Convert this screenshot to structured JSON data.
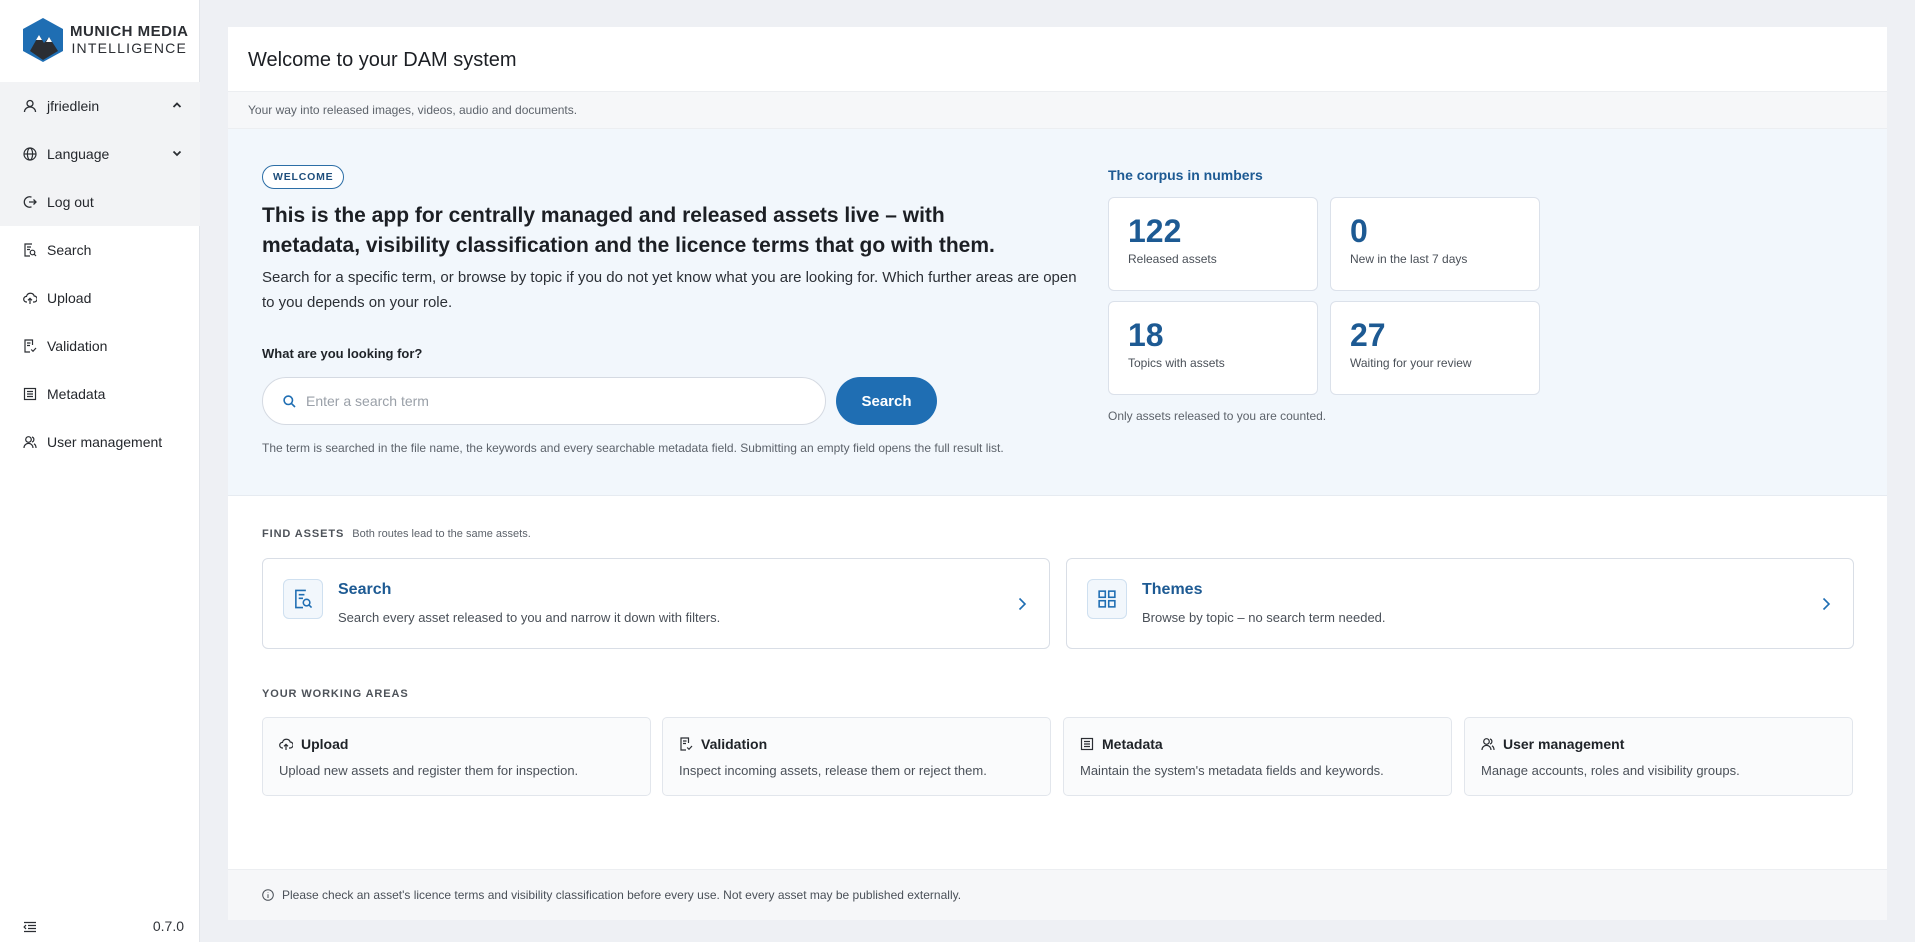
{
  "brand": {
    "line1": "MUNICH MEDIA",
    "line2": "INTELLIGENCE"
  },
  "sidebar": {
    "user": {
      "label": "jfriedlein",
      "icon": "user-icon"
    },
    "language": {
      "label": "Language",
      "icon": "globe-icon"
    },
    "logout": {
      "label": "Log out",
      "icon": "logout-icon"
    },
    "items": [
      {
        "label": "Search",
        "icon": "search-doc-icon"
      },
      {
        "label": "Upload",
        "icon": "cloud-upload-icon"
      },
      {
        "label": "Validation",
        "icon": "check-doc-icon"
      },
      {
        "label": "Metadata",
        "icon": "list-doc-icon"
      },
      {
        "label": "User management",
        "icon": "users-icon"
      }
    ],
    "version": "0.7.0"
  },
  "header": {
    "title": "Welcome to your DAM system",
    "subtitle": "Your way into released images, videos, audio and documents."
  },
  "hero": {
    "badge": "WELCOME",
    "title": "This is the app for centrally managed and released assets live – with metadata, visibility classification and the licence terms that go with them.",
    "description": "Search for a specific term, or browse by topic if you do not yet know what you are looking for. Which further areas are open to you depends on your role.",
    "search_label": "What are you looking for?",
    "search_placeholder": "Enter a search term",
    "search_value": "",
    "search_button": "Search",
    "search_hint": "The term is searched in the file name, the keywords and every searchable metadata field. Submitting an empty field opens the full result list."
  },
  "corpus": {
    "title": "The corpus in numbers",
    "stats": [
      {
        "value": "122",
        "label": "Released assets"
      },
      {
        "value": "0",
        "label": "New in the last 7 days"
      },
      {
        "value": "18",
        "label": "Topics with assets"
      },
      {
        "value": "27",
        "label": "Waiting for your review"
      }
    ],
    "note": "Only assets released to you are counted."
  },
  "find_assets": {
    "heading": "FIND ASSETS",
    "subheading": "Both routes lead to the same assets.",
    "cards": [
      {
        "title": "Search",
        "description": "Search every asset released to you and narrow it down with filters.",
        "icon": "search-doc-icon"
      },
      {
        "title": "Themes",
        "description": "Browse by topic – no search term needed.",
        "icon": "grid-icon"
      }
    ]
  },
  "working_areas": {
    "heading": "YOUR WORKING AREAS",
    "cards": [
      {
        "title": "Upload",
        "description": "Upload new assets and register them for inspection.",
        "icon": "cloud-upload-icon"
      },
      {
        "title": "Validation",
        "description": "Inspect incoming assets, release them or reject them.",
        "icon": "check-doc-icon"
      },
      {
        "title": "Metadata",
        "description": "Maintain the system's metadata fields and keywords.",
        "icon": "list-doc-icon"
      },
      {
        "title": "User management",
        "description": "Manage accounts, roles and visibility groups.",
        "icon": "users-icon"
      }
    ]
  },
  "footer": {
    "notice": "Please check an asset's licence terms and visibility classification before every use. Not every asset may be published externally."
  },
  "colors": {
    "accent": "#1f6eb3",
    "accent_dark": "#1d5a93",
    "hero_bg": "#f2f7fc",
    "page_bg": "#eef0f4"
  }
}
